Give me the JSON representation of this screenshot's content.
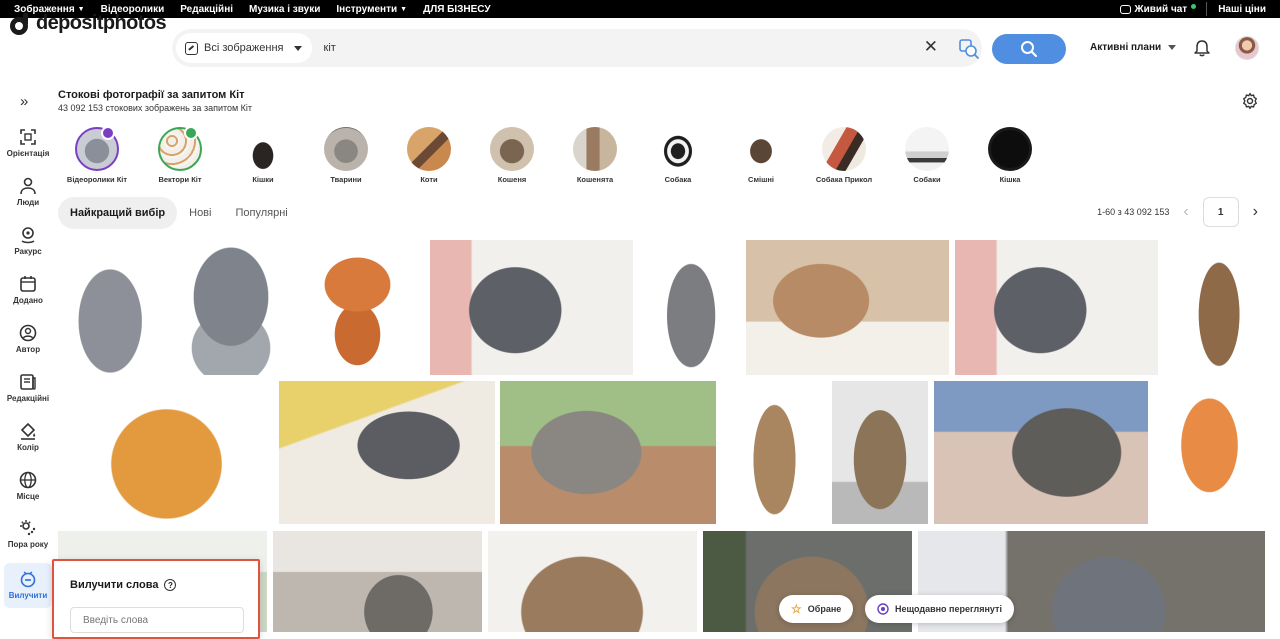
{
  "topbar": {
    "nav": [
      {
        "label": "Зображення",
        "caret": true
      },
      {
        "label": "Відеоролики",
        "caret": false
      },
      {
        "label": "Редакційні",
        "caret": false
      },
      {
        "label": "Музика і звуки",
        "caret": false
      },
      {
        "label": "Інструменти",
        "caret": true
      },
      {
        "label": "ДЛЯ БІЗНЕСУ",
        "caret": false
      }
    ],
    "live_chat": "Живий чат",
    "prices": "Наші ціни"
  },
  "header": {
    "logo": "depositphotos",
    "category": "Всі зображення",
    "query": "кіт",
    "plans": "Активні плани",
    "accent": "#4f8ee0"
  },
  "sidebar": {
    "items": [
      {
        "label": "Орієнтація",
        "icon": "orientation-icon"
      },
      {
        "label": "Люди",
        "icon": "people-icon"
      },
      {
        "label": "Ракурс",
        "icon": "viewpoint-icon"
      },
      {
        "label": "Додано",
        "icon": "calendar-icon"
      },
      {
        "label": "Автор",
        "icon": "author-icon"
      },
      {
        "label": "Редакційні",
        "icon": "editorial-icon"
      },
      {
        "label": "Колір",
        "icon": "color-bucket-icon"
      },
      {
        "label": "Місце",
        "icon": "globe-icon"
      },
      {
        "label": "Пора року",
        "icon": "season-icon"
      },
      {
        "label": "Вилучити",
        "icon": "exclude-icon"
      }
    ]
  },
  "page": {
    "title": "Стокові фотографії за запитом Кіт",
    "subtitle": "43 092 153 стокових зображень за запитом Кіт"
  },
  "chips": [
    {
      "label": "Відеоролики Кіт",
      "badge": "video"
    },
    {
      "label": "Вектори Кіт",
      "badge": "vector"
    },
    {
      "label": "Кішки"
    },
    {
      "label": "Тварини"
    },
    {
      "label": "Коти"
    },
    {
      "label": "Кошеня"
    },
    {
      "label": "Кошенята"
    },
    {
      "label": "Собака"
    },
    {
      "label": "Смішні"
    },
    {
      "label": "Собака Прикол"
    },
    {
      "label": "Собаки"
    },
    {
      "label": "Кішка"
    }
  ],
  "sort": {
    "tabs": [
      "Найкращий вибір",
      "Нові",
      "Популярні"
    ],
    "active": 0
  },
  "pagination": {
    "range": "1-60 з 43 092 153",
    "page": "1"
  },
  "exclude": {
    "title": "Вилучити слова",
    "placeholder": "Введіть слова",
    "help": "?"
  },
  "floating": {
    "favorites": "Обране",
    "recent": "Нещодавно переглянуті"
  }
}
